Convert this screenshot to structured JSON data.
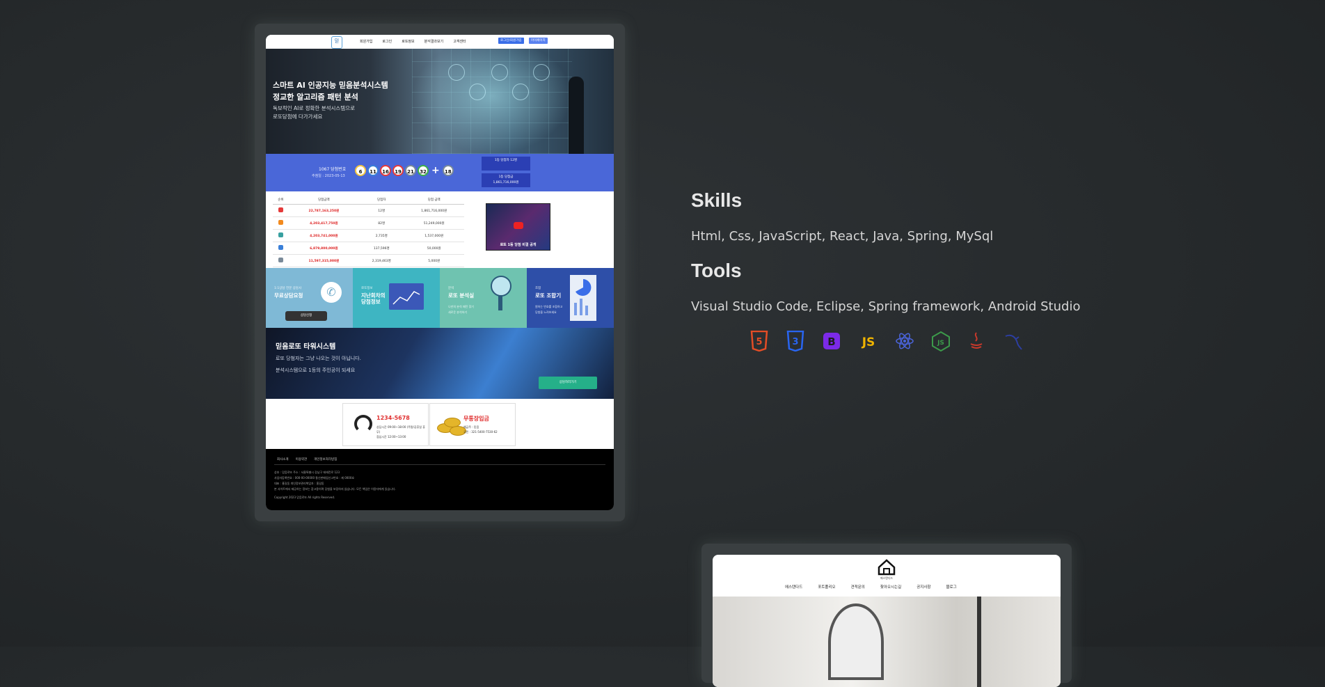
{
  "colors": {
    "accent_blue": "#4a67d8",
    "dark_blue": "#2b3fb4",
    "footer_bg": "#000000",
    "green_btn": "#25b089",
    "red_text": "#e03030",
    "page_bg": "#262a2c"
  },
  "project1": {
    "header": {
      "logo_text": "믿",
      "nav": [
        "회원가입",
        "로그인",
        "로또정보",
        "분석결과보기",
        "고객센터"
      ],
      "btn_login": "로그인/회원가입",
      "btn_mypage": "마이페이지"
    },
    "hero": {
      "title_line1": "스마트 AI 인공지능 믿음분석시스템",
      "title_line2": "정교한 알고리즘 패턴 분석",
      "sub_line1": "독보적인 AI로 정확한 분석시스템으로",
      "sub_line2": "로또당첨에 다가가세요"
    },
    "lotto": {
      "round": "1067 당첨번호",
      "date": "추첨일 : 2023-05-13",
      "numbers": [
        "6",
        "11",
        "16",
        "19",
        "21",
        "32"
      ],
      "bonus": "18",
      "box1": "1등 당첨자 12명",
      "box2_line1": "1등 당첨금",
      "box2_line2": "1,861,716,000원"
    },
    "table": {
      "headers": [
        "순위",
        "당첨금액",
        "당첨자",
        "당첨 금액"
      ],
      "rows": [
        {
          "amount": "22,787,163,250원",
          "winners": "12명",
          "per": "1,861,716,000원",
          "color": "#e53a3a"
        },
        {
          "amount": "4,203,417,750원",
          "winners": "82명",
          "per": "51,249,000원",
          "color": "#f28a1e"
        },
        {
          "amount": "4,203,741,000원",
          "winners": "2,735명",
          "per": "1,537,000원",
          "color": "#38a0a0"
        },
        {
          "amount": "6,879,800,000원",
          "winners": "137,596명",
          "per": "50,000원",
          "color": "#3a7fd8"
        },
        {
          "amount": "11,597,315,000원",
          "winners": "2,319,463명",
          "per": "5,000원",
          "color": "#7a8a99"
        }
      ]
    },
    "video": {
      "caption": "로또 1등 당첨 비결 공개"
    },
    "tiles": [
      {
        "t1": "1:1상담 전문 상담사",
        "t2": "무료상담요청",
        "btn": "상담신청",
        "bg": "#7fb9d6"
      },
      {
        "t1": "로또정보",
        "t2": "지난회차의\n당첨정보",
        "bg": "#3eb5c2"
      },
      {
        "t1": "분석",
        "t2": "로또 분석실",
        "t3": "나만의 분석 패턴 찾기\n새로운 분석하기",
        "bg": "#6fc3b0"
      },
      {
        "t1": "조합",
        "t2": "로또 조합기",
        "t3": "원하는 번호를 조합하고\n당첨을 노려보세요",
        "bg": "#2e4fa8"
      }
    ],
    "tower": {
      "title": "믿음로또 타워시스템",
      "line1": "로또 당첨자는 그냥 나오는 것이 아닙니다.",
      "line2": "분석시스템으로 1등의 주인공이 되세요",
      "btn": "상담하러가기"
    },
    "contact": {
      "phone": "1234-5678",
      "phone_l1": "상담시간 09:00~18:00 (주말/공휴일 휴무)",
      "phone_l2": "점심시간 12:00~13:00",
      "bank_title": "무통장입금",
      "bank_l1": "예금주 : 믿음",
      "bank_l2": "국민 : 321-5400-7530-62"
    },
    "footer": {
      "links": [
        "회사소개",
        "이용약관",
        "개인정보처리방침"
      ],
      "lines": [
        "상호 : 믿음로또 주소 : 서울특별시 강남구 테헤란로 123",
        "사업자등록번호 : 000-00-00000 통신판매업신고번호 : 제 0000호",
        "대표 : 홍길동 개인정보관리책임자 : 홍길동",
        "본 사이트에서 제공하는 정보는 참고용이며 당첨을 보장하지 않습니다. 모든 책임은 이용자에게 있습니다.",
        "Copyright 2023 믿음로또 All rights Reserved."
      ]
    }
  },
  "skills": {
    "heading": "Skills",
    "text": "Html, Css, JavaScript, React, Java, Spring, MySql"
  },
  "tools": {
    "heading": "Tools",
    "text": "Visual Studio Code, Eclipse, Spring framework, Android Studio"
  },
  "tech_icons": [
    {
      "name": "html5-icon",
      "glyph": "5",
      "color": "#e44d26"
    },
    {
      "name": "css3-icon",
      "glyph": "3",
      "color": "#2965f1"
    },
    {
      "name": "bootstrap-icon",
      "glyph": "B",
      "color": "#7c2ae8"
    },
    {
      "name": "javascript-icon",
      "glyph": "JS",
      "color": "#f0b400"
    },
    {
      "name": "react-icon",
      "glyph": "⚛",
      "color": "#4a63d8"
    },
    {
      "name": "nodejs-icon",
      "glyph": "JS",
      "color": "#3c9a4a"
    },
    {
      "name": "java-icon",
      "glyph": "♨",
      "color": "#c8392b"
    },
    {
      "name": "mysql-icon",
      "glyph": "∿",
      "color": "#2c3ea0"
    }
  ],
  "project2": {
    "logo_text": "에스탠다드",
    "nav": [
      "에스탠다드",
      "포트폴리오",
      "견적문의",
      "찾아오시는길",
      "공지사항",
      "블로그"
    ]
  }
}
